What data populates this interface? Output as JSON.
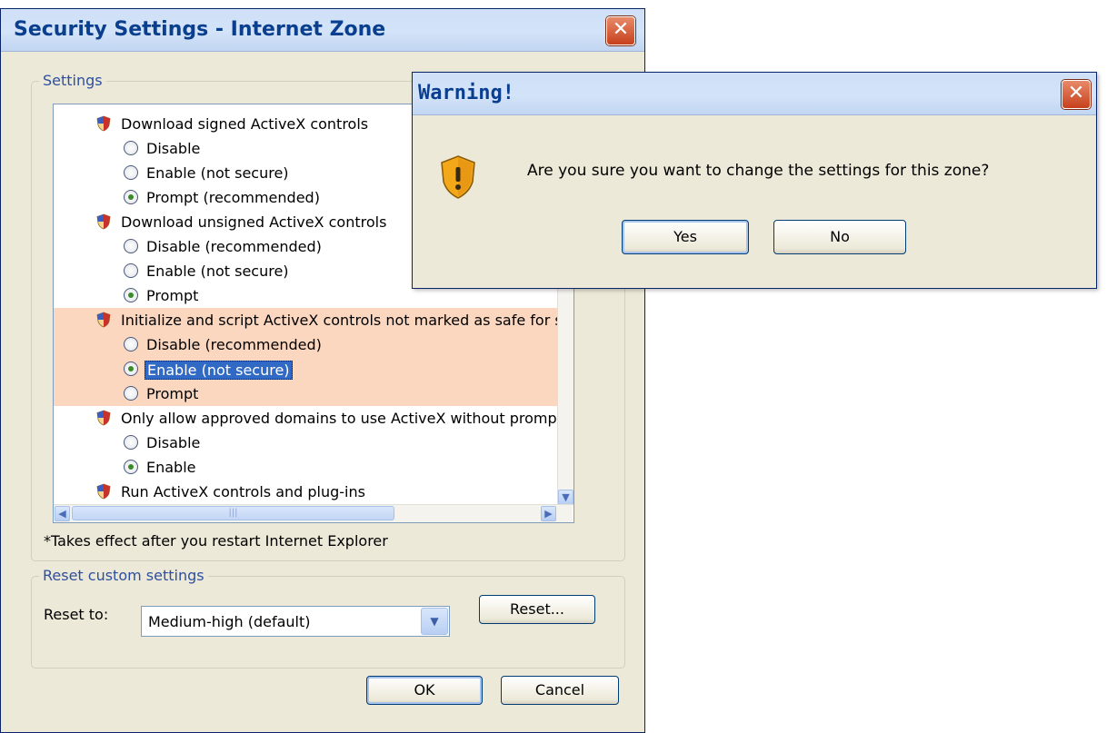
{
  "main_dialog": {
    "title": "Security Settings - Internet Zone",
    "settings_group_label": "Settings",
    "items": [
      {
        "type": "heading",
        "text": "Download signed ActiveX controls"
      },
      {
        "type": "option",
        "text": "Disable",
        "checked": false
      },
      {
        "type": "option",
        "text": "Enable (not secure)",
        "checked": false
      },
      {
        "type": "option",
        "text": "Prompt (recommended)",
        "checked": true
      },
      {
        "type": "heading",
        "text": "Download unsigned ActiveX controls"
      },
      {
        "type": "option",
        "text": "Disable (recommended)",
        "checked": false
      },
      {
        "type": "option",
        "text": "Enable (not secure)",
        "checked": false
      },
      {
        "type": "option",
        "text": "Prompt",
        "checked": true
      },
      {
        "type": "heading",
        "text": "Initialize and script ActiveX controls not marked as safe for sc",
        "highlight": true
      },
      {
        "type": "option",
        "text": "Disable (recommended)",
        "checked": false,
        "highlight": true
      },
      {
        "type": "option",
        "text": "Enable (not secure)",
        "checked": true,
        "highlight": true,
        "selected": true
      },
      {
        "type": "option",
        "text": "Prompt",
        "checked": false,
        "highlight": true
      },
      {
        "type": "heading",
        "text": "Only allow approved domains to use ActiveX without prompt"
      },
      {
        "type": "option",
        "text": "Disable",
        "checked": false
      },
      {
        "type": "option",
        "text": "Enable",
        "checked": true
      },
      {
        "type": "heading",
        "text": "Run ActiveX controls and plug-ins"
      }
    ],
    "restart_note": "*Takes effect after you restart Internet Explorer",
    "reset_group_label": "Reset custom settings",
    "reset_to_label": "Reset to:",
    "reset_to_value": "Medium-high (default)",
    "reset_button": "Reset...",
    "ok_button": "OK",
    "cancel_button": "Cancel"
  },
  "warning_dialog": {
    "title": "Warning!",
    "message": "Are you sure you want to change the settings for this zone?",
    "yes_button": "Yes",
    "no_button": "No"
  },
  "colors": {
    "dialog_bg": "#ece9d8",
    "title_text": "#0a3f8f",
    "highlight_row": "#fbd7c0",
    "selection": "#316ac5"
  }
}
